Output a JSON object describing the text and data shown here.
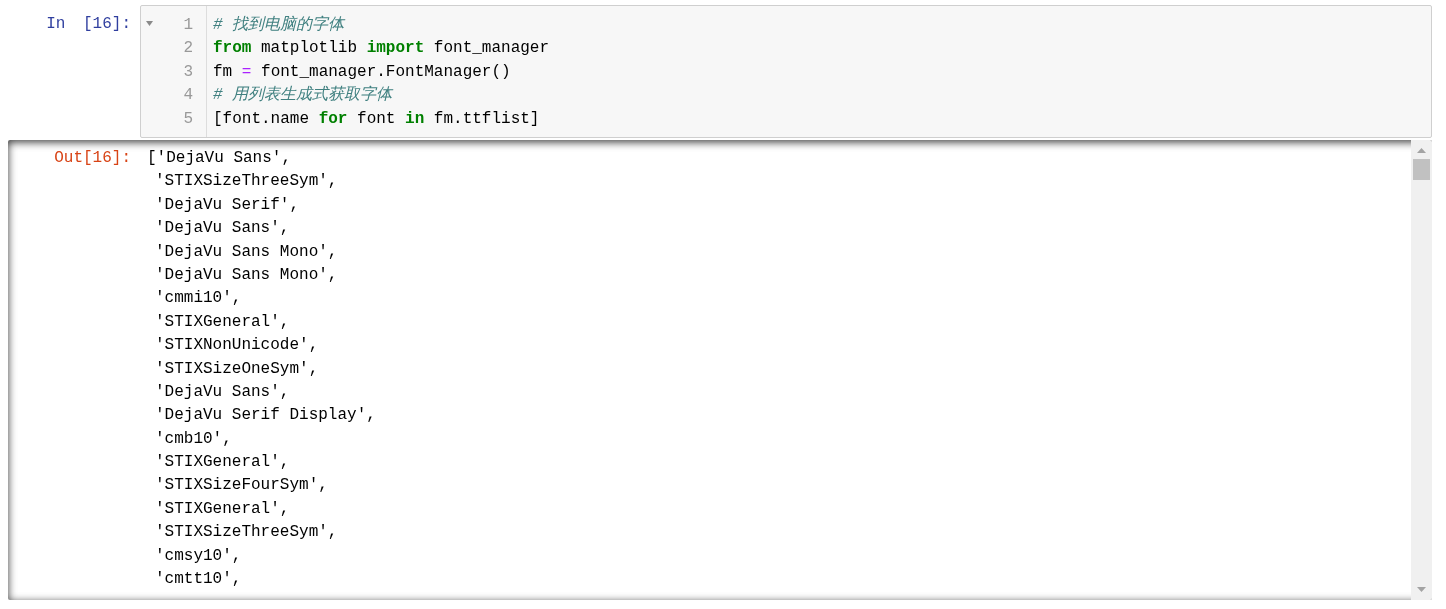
{
  "input_cell": {
    "prompt": "In [16]:",
    "fold_expanded": true,
    "code_lines": [
      {
        "number": "1",
        "tokens": [
          {
            "kind": "comment",
            "text": "# 找到电脑的字体"
          }
        ]
      },
      {
        "number": "2",
        "tokens": [
          {
            "kind": "keyword",
            "text": "from"
          },
          {
            "kind": "plain",
            "text": " matplotlib "
          },
          {
            "kind": "keyword",
            "text": "import"
          },
          {
            "kind": "plain",
            "text": " font_manager"
          }
        ]
      },
      {
        "number": "3",
        "tokens": [
          {
            "kind": "plain",
            "text": "fm "
          },
          {
            "kind": "operator",
            "text": "="
          },
          {
            "kind": "plain",
            "text": " font_manager.FontManager()"
          }
        ]
      },
      {
        "number": "4",
        "tokens": [
          {
            "kind": "comment",
            "text": "# 用列表生成式获取字体"
          }
        ]
      },
      {
        "number": "5",
        "tokens": [
          {
            "kind": "plain",
            "text": "[font.name "
          },
          {
            "kind": "keyword",
            "text": "for"
          },
          {
            "kind": "plain",
            "text": " font "
          },
          {
            "kind": "keyword",
            "text": "in"
          },
          {
            "kind": "plain",
            "text": " fm.ttflist]"
          }
        ]
      }
    ]
  },
  "output_cell": {
    "prompt": "Out[16]:",
    "lines": [
      "['DejaVu Sans',",
      "'STIXSizeThreeSym',",
      "'DejaVu Serif',",
      "'DejaVu Sans',",
      "'DejaVu Sans Mono',",
      "'DejaVu Sans Mono',",
      "'cmmi10',",
      "'STIXGeneral',",
      "'STIXNonUnicode',",
      "'STIXSizeOneSym',",
      "'DejaVu Sans',",
      "'DejaVu Serif Display',",
      "'cmb10',",
      "'STIXGeneral',",
      "'STIXSizeFourSym',",
      "'STIXGeneral',",
      "'STIXSizeThreeSym',",
      "'cmsy10',",
      "'cmtt10',"
    ]
  }
}
